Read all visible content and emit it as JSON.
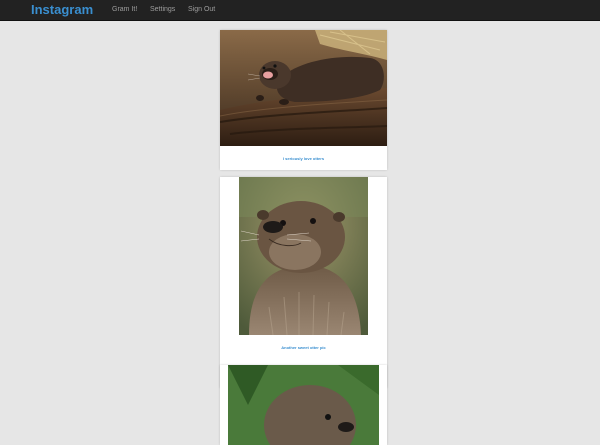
{
  "navbar": {
    "brand": "Instagram",
    "links": [
      "Gram It!",
      "Settings",
      "Sign Out"
    ]
  },
  "posts": [
    {
      "caption": "I seriously love otters",
      "image": "otter-lying-on-log-photo"
    },
    {
      "caption": "Another sweet otter pic",
      "image": "otter-portrait-photo"
    },
    {
      "caption": "",
      "image": "otter-partial-photo"
    }
  ],
  "colors": {
    "navbar_bg": "#222222",
    "brand": "#3a8fd0",
    "nav_link": "#9d9d9d",
    "page_bg": "#e6e6e6",
    "caption": "#3a8fd0"
  }
}
